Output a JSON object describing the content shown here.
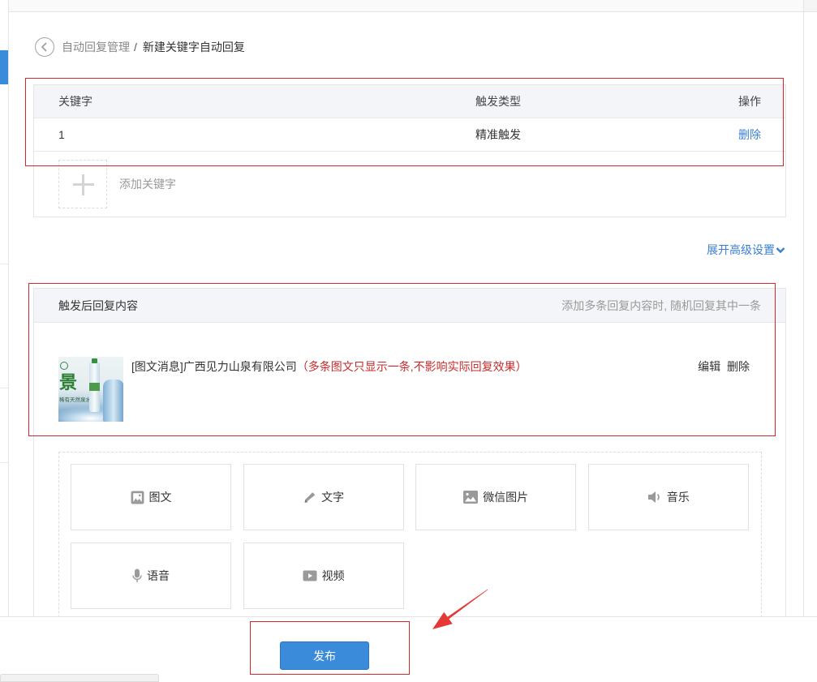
{
  "breadcrumb": {
    "back_icon": "back-circle-icon",
    "parent": "自动回复管理",
    "separator": "/",
    "current": "新建关键字自动回复"
  },
  "keyword_table": {
    "columns": [
      "关键字",
      "触发类型",
      "操作"
    ],
    "rows": [
      {
        "keyword": "1",
        "trigger_type": "精准触发",
        "action": "删除"
      }
    ],
    "add_icon": "plus-icon",
    "add_label": "添加关键字"
  },
  "advanced_settings": {
    "label": "展开高级设置",
    "icon": "chevron-down-icon"
  },
  "reply_content": {
    "title": "触发后回复内容",
    "hint": "添加多条回复内容时, 随机回复其中一条",
    "items": [
      {
        "label": "[图文消息]广西见力山泉有限公司",
        "note": "（多条图文只显示一条,不影响实际回复效果）",
        "edit_label": "编辑",
        "delete_label": "删除",
        "thumbnail": {
          "headline_char": "景",
          "tagline": "稀有天然泉水"
        }
      }
    ],
    "add_types": [
      {
        "label": "图文",
        "icon": "news-icon"
      },
      {
        "label": "文字",
        "icon": "pencil-icon"
      },
      {
        "label": "微信图片",
        "icon": "image-icon"
      },
      {
        "label": "音乐",
        "icon": "speaker-icon"
      },
      {
        "label": "语音",
        "icon": "microphone-icon"
      },
      {
        "label": "视频",
        "icon": "video-icon"
      }
    ]
  },
  "footer": {
    "publish_label": "发布"
  },
  "colors": {
    "accent": "#3b8bdb",
    "link": "#3a7fd5",
    "annotation_red": "#d6282b",
    "note_red": "#c62b2b",
    "header_bg": "#f4f5f9",
    "border": "#e6e6e6"
  }
}
